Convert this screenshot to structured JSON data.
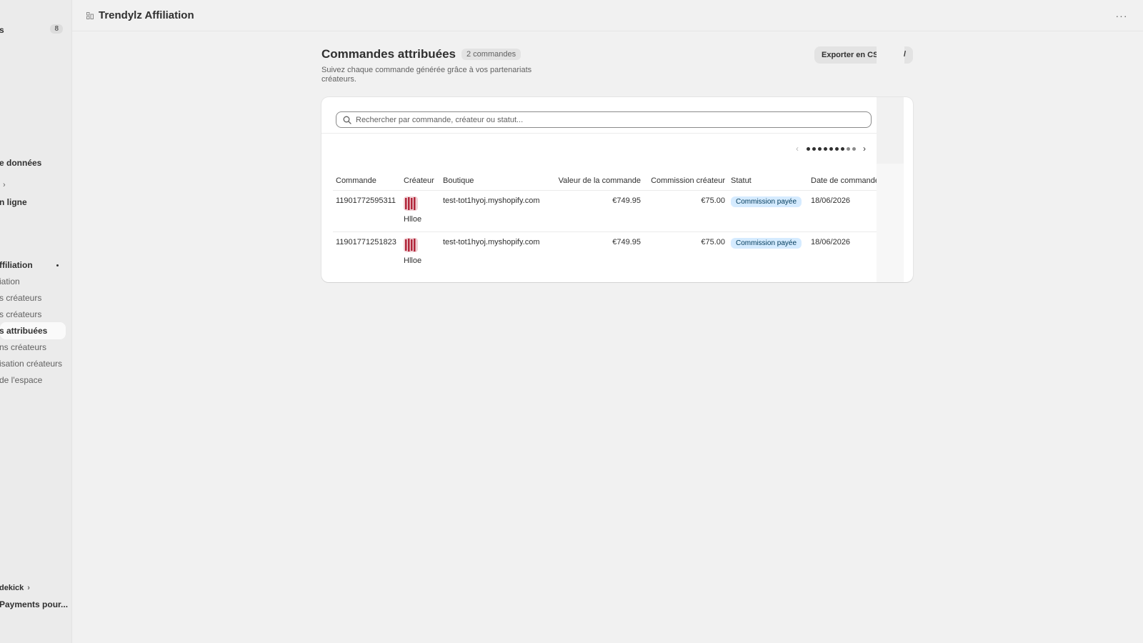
{
  "sidebar": {
    "items": [
      {
        "label": "s",
        "badge": "8"
      },
      {
        "label": "e données"
      },
      {
        "label": ""
      },
      {
        "label": "n ligne"
      },
      {
        "label": "ffiliation"
      },
      {
        "label": "iation"
      },
      {
        "label": "s créateurs"
      },
      {
        "label": "s créateurs"
      },
      {
        "label": "s attribuées"
      },
      {
        "label": "ns créateurs"
      },
      {
        "label": "isation créateurs"
      },
      {
        "label": " de l'espace"
      },
      {
        "label": "dekick"
      },
      {
        "label": "Payments pour..."
      }
    ]
  },
  "topbar": {
    "app_title": "Trendylz Affiliation",
    "more_label": "···"
  },
  "page": {
    "title": "Commandes attribuées",
    "count_badge": "2 commandes",
    "subtitle": "Suivez chaque commande générée grâce à vos partenariats créateurs.",
    "export_label": "Exporter en CSV",
    "export_tail": "/"
  },
  "search": {
    "placeholder": "Rechercher par commande, créateur ou statut..."
  },
  "pager": {
    "prev": "‹",
    "next": "›"
  },
  "table": {
    "headers": [
      "Commande",
      "Créateur",
      "Boutique",
      "Valeur de la commande",
      "Commission créateur",
      "Statut",
      "Date de commande"
    ],
    "rows": [
      {
        "order": "11901772595311",
        "creator": "Hlloe",
        "shop": "test-tot1hyoj.myshopify.com",
        "value": "€749.95",
        "commission": "€75.00",
        "status": "Commission payée",
        "date": "18/06/2026"
      },
      {
        "order": "11901771251823",
        "creator": "Hlloe",
        "shop": "test-tot1hyoj.myshopify.com",
        "value": "€749.95",
        "commission": "€75.00",
        "status": "Commission payée",
        "date": "18/06/2026"
      }
    ]
  },
  "colors": {
    "status_bg": "#d5ebff",
    "status_text": "#003a5a",
    "avatar_red": "#b1253a"
  }
}
